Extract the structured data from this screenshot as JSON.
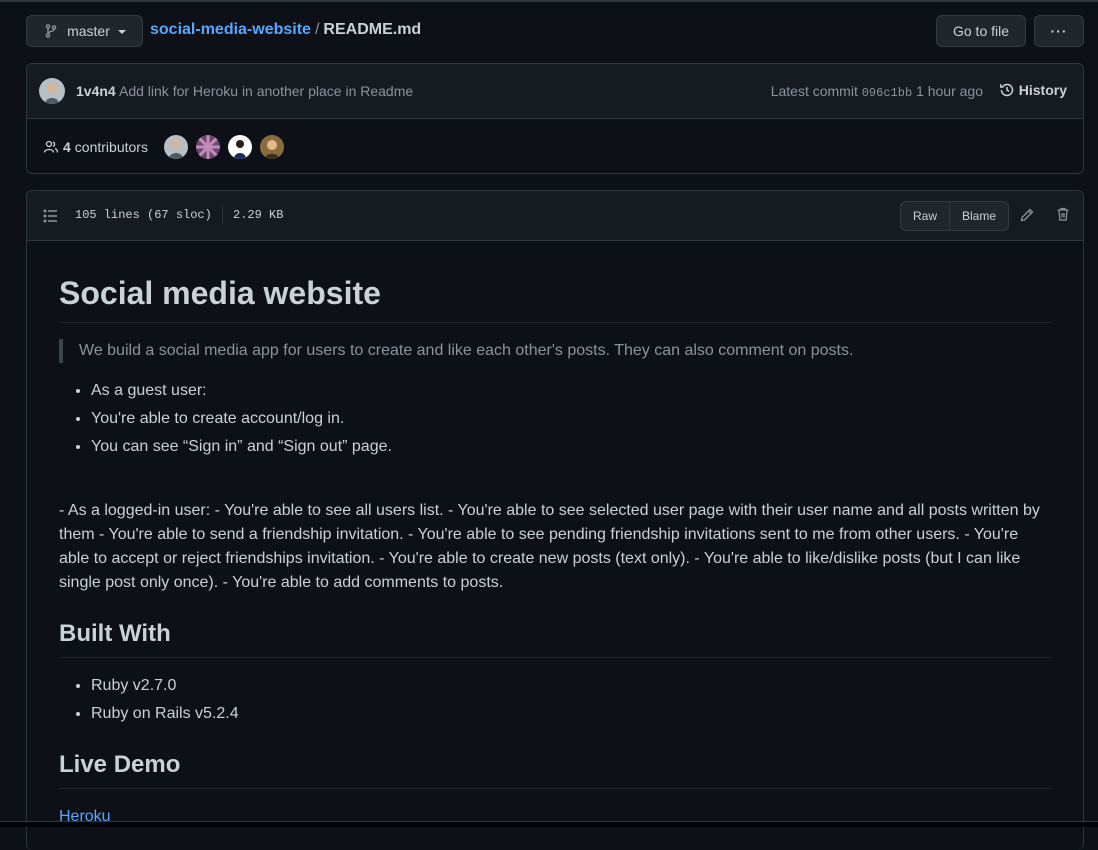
{
  "header": {
    "branch_name": "master",
    "repo_name": "social-media-website",
    "separator": "/",
    "file_name": "README.md",
    "go_to_file_label": "Go to file",
    "more_label": "···"
  },
  "commit": {
    "author": "1v4n4",
    "message": "Add link for Heroku in another place in Readme",
    "latest_label": "Latest commit",
    "hash": "096c1bb",
    "time": "1 hour ago",
    "history_label": "History"
  },
  "contributors": {
    "count": "4",
    "label": "contributors"
  },
  "file_header": {
    "lines": "105 lines (67 sloc)",
    "size": "2.29 KB",
    "raw_label": "Raw",
    "blame_label": "Blame"
  },
  "readme": {
    "title": "Social media website",
    "intro": "We build a social media app for users to create and like each other's posts. They can also comment on posts.",
    "guest_items": [
      "As a guest user:",
      "You're able to create account/log in.",
      "You can see “Sign in” and “Sign out” page."
    ],
    "logged_in_paragraph": "- As a logged-in user: - You're able to see all users list. - You're able to see selected user page with their user name and all posts written by them - You're able to send a friendship invitation. - You're able to see pending friendship invitations sent to me from other users. - You're able to accept or reject friendships invitation. - You're able to create new posts (text only). - You're able to like/dislike posts (but I can like single post only once). - You're able to add comments to posts.",
    "built_with_heading": "Built With",
    "built_with_items": [
      "Ruby v2.7.0",
      "Ruby on Rails v5.2.4"
    ],
    "live_demo_heading": "Live Demo",
    "live_demo_link": "Heroku"
  },
  "colors": {
    "background": "#0d1117",
    "panel": "#161b22",
    "border": "#30363d",
    "link": "#58a6ff",
    "muted": "#8b949e",
    "text": "#c9d1d9"
  },
  "icons": [
    "git-branch-icon",
    "history-icon",
    "people-icon",
    "list-icon",
    "pencil-icon",
    "trash-icon",
    "kebab-icon"
  ]
}
